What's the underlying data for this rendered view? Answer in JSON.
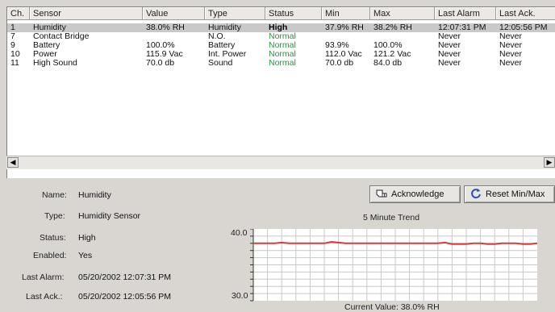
{
  "table": {
    "columns": [
      "Ch.",
      "Sensor",
      "Value",
      "Type",
      "Status",
      "Min",
      "Max",
      "Last Alarm",
      "Last Ack."
    ],
    "rows": [
      [
        "1",
        "Humidity",
        "38.0% RH",
        "Humidity",
        "High",
        "37.9% RH",
        "38.2% RH",
        "12:07:31 PM",
        "12:05:56 PM"
      ],
      [
        "7",
        "Contact Bridge",
        "",
        "N.O.",
        "Normal",
        "",
        "",
        "Never",
        "Never"
      ],
      [
        "9",
        "Battery",
        "100.0%",
        "Battery",
        "Normal",
        "93.9%",
        "100.0%",
        "Never",
        "Never"
      ],
      [
        "10",
        "Power",
        "115.9 Vac",
        "Int. Power",
        "Normal",
        "112.0 Vac",
        "121.2 Vac",
        "Never",
        "Never"
      ],
      [
        "11",
        "High Sound",
        "70.0 db",
        "Sound",
        "Normal",
        "70.0 db",
        "84.0 db",
        "Never",
        "Never"
      ]
    ],
    "selected_row": 0,
    "status_colors": {
      "Normal": "#1f9a3a",
      "High": "#000000"
    }
  },
  "details": {
    "name_label": "Name:",
    "name_value": "Humidity",
    "type_label": "Type:",
    "type_value": "Humidity Sensor",
    "status_label": "Status:",
    "status_value": "High",
    "enabled_label": "Enabled:",
    "enabled_value": "Yes",
    "last_alarm_label": "Last Alarm:",
    "last_alarm_value": "05/20/2002 12:07:31 PM",
    "last_ack_label": "Last Ack.:",
    "last_ack_value": "05/20/2002 12:05:56 PM"
  },
  "buttons": {
    "acknowledge": "Acknowledge",
    "acknowledge_icon": "hand-pointer-icon",
    "reset": "Reset Min/Max",
    "reset_icon": "refresh-icon"
  },
  "trend": {
    "title": "5 Minute Trend",
    "current_label": "Current Value: 38.0% RH",
    "y_max_label": "40.0",
    "y_min_label": "30.0",
    "line_color": "#d93a3a",
    "grid_color": "#c8c8c8"
  },
  "chart_data": {
    "type": "line",
    "title": "5 Minute Trend",
    "ylim": [
      30.0,
      40.0
    ],
    "grid": true,
    "series": [
      {
        "values": [
          38.0,
          38.0,
          38.0,
          38.0,
          38.1,
          38.0,
          38.0,
          38.0,
          38.0,
          38.0,
          38.0,
          38.2,
          38.1,
          38.0,
          38.0,
          38.0,
          38.0,
          38.0,
          38.0,
          38.0,
          38.0,
          38.0,
          38.0,
          38.0,
          38.0,
          38.0,
          38.0,
          38.1,
          37.9,
          37.9,
          37.9,
          38.0,
          38.0,
          37.9,
          37.9,
          38.0,
          38.0,
          38.0,
          37.9,
          37.9,
          38.0
        ]
      }
    ]
  }
}
